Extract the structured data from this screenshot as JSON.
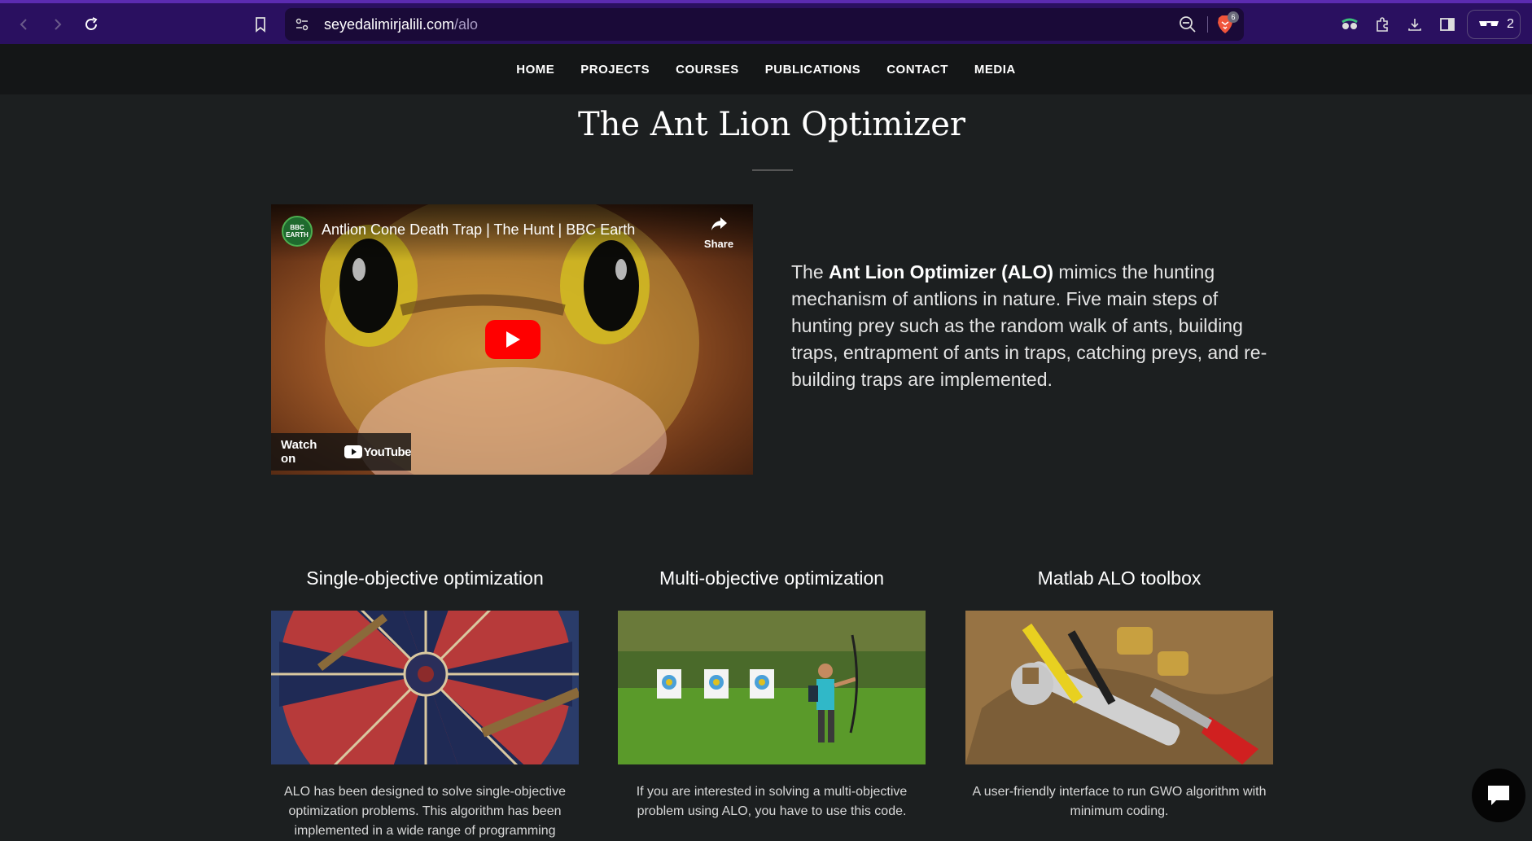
{
  "browser": {
    "url_domain": "seyedalimirjalili.com",
    "url_path": "/alo",
    "shields_badge": "6",
    "profile_count": "2",
    "accent_color": "#2a1060"
  },
  "nav": {
    "items": [
      "HOME",
      "PROJECTS",
      "COURSES",
      "PUBLICATIONS",
      "CONTACT",
      "MEDIA"
    ]
  },
  "page": {
    "title": "The Ant Lion Optimizer"
  },
  "video": {
    "channel": "BBC EARTH",
    "title": "Antlion Cone Death Trap | The Hunt | BBC Earth",
    "share_label": "Share",
    "watch_on_label": "Watch on",
    "platform": "YouTube"
  },
  "intro": {
    "pre": "The ",
    "bold": "Ant Lion Optimizer (ALO)",
    "post": " mimics the hunting mechanism of antlions in nature. Five main steps of hunting prey such as the random walk of ants, building traps, entrapment of ants in traps, catching preys, and re-building traps are implemented."
  },
  "cards": [
    {
      "title": "Single-objective optimization",
      "text": "ALO has been designed to solve single-objective optimization problems. This algorithm has been implemented in a wide range of programming"
    },
    {
      "title": "Multi-objective optimization",
      "text": "If you are interested in solving a multi-objective problem using ALO, you have to use this code."
    },
    {
      "title": "Matlab ALO toolbox",
      "text": "A user-friendly interface to run GWO algorithm with minimum coding."
    }
  ]
}
